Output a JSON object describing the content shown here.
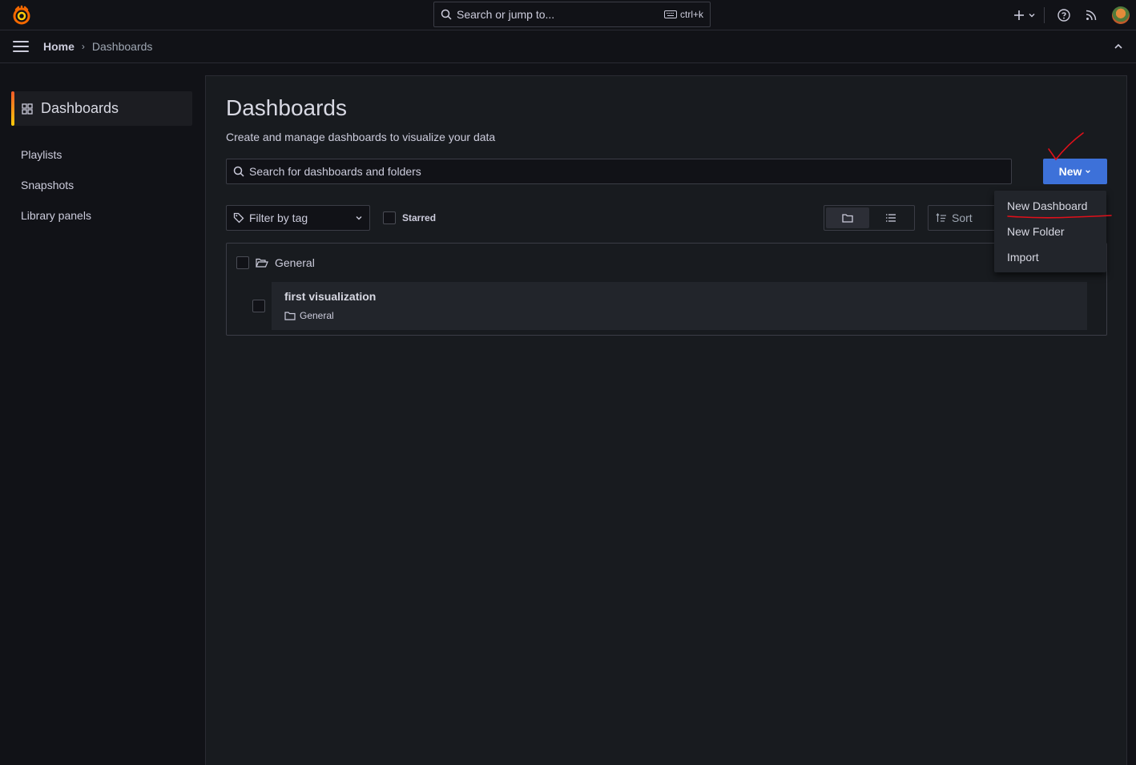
{
  "topbar": {
    "search_placeholder": "Search or jump to...",
    "search_shortcut": "ctrl+k",
    "icons": [
      "grafana-logo-icon",
      "search-icon",
      "keyboard-icon",
      "plus-icon",
      "chevron-down-icon",
      "help-icon",
      "rss-icon",
      "avatar"
    ]
  },
  "breadcrumb": {
    "home": "Home",
    "separator": "›",
    "current": "Dashboards"
  },
  "sidebar": {
    "active_label": "Dashboards",
    "items": [
      {
        "label": "Playlists"
      },
      {
        "label": "Snapshots"
      },
      {
        "label": "Library panels"
      }
    ]
  },
  "main": {
    "title": "Dashboards",
    "subtitle": "Create and manage dashboards to visualize your data",
    "search_placeholder": "Search for dashboards and folders",
    "new_button_label": "New",
    "filter_tag_placeholder": "Filter by tag",
    "starred_label": "Starred",
    "sort_label": "Sort",
    "folder": {
      "name": "General",
      "dashboards": [
        {
          "title": "first visualization",
          "location": "General"
        }
      ]
    }
  },
  "new_menu": {
    "items": [
      {
        "label": "New Dashboard"
      },
      {
        "label": "New Folder"
      },
      {
        "label": "Import"
      }
    ]
  },
  "colors": {
    "background": "#111217",
    "panel": "#181b1f",
    "primary_button": "#3d71d9",
    "annotation": "#e0101a",
    "accent_gradient_start": "#f05a28",
    "accent_gradient_end": "#fbca0a"
  }
}
